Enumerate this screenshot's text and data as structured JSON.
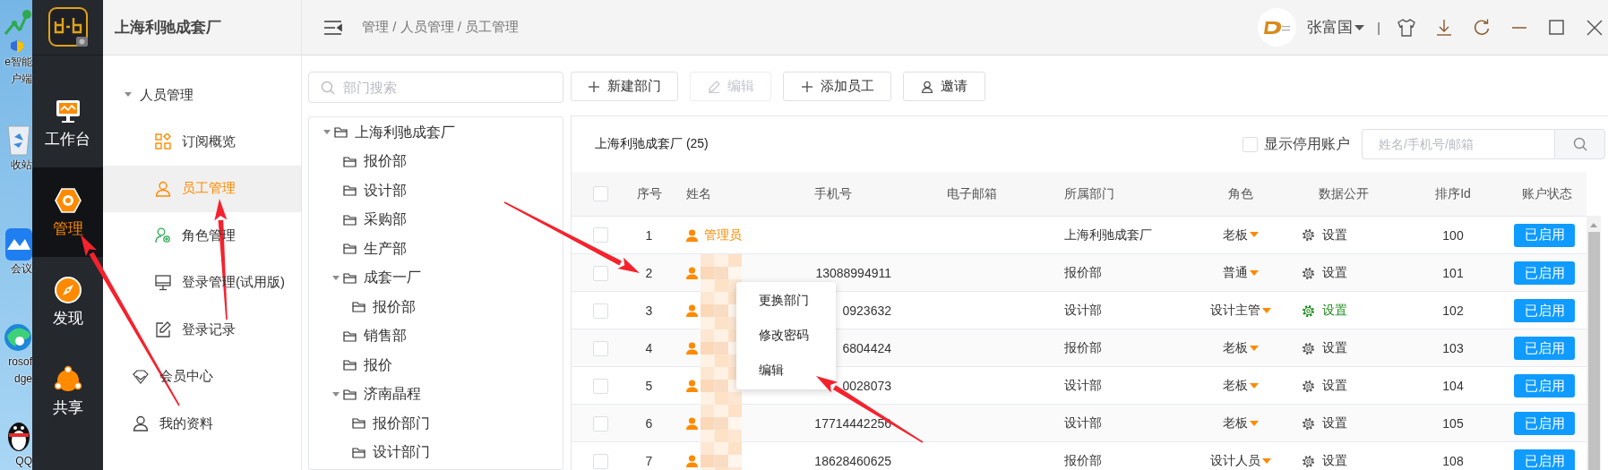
{
  "desktop": {
    "icons": [
      {
        "kind": "network",
        "lines": [
          "e智能",
          "户端"
        ]
      },
      {
        "kind": "bin",
        "lines": [
          "收站"
        ]
      },
      {
        "kind": "meeting",
        "lines": [
          "会议"
        ]
      },
      {
        "kind": "browser",
        "lines": [
          "rosof",
          "dge"
        ]
      },
      {
        "kind": "penguin",
        "lines": [
          "QQ"
        ]
      }
    ]
  },
  "nav": {
    "items": [
      {
        "kind": "workbench",
        "label": "工作台",
        "selected": false
      },
      {
        "kind": "manage",
        "label": "管理",
        "selected": true
      },
      {
        "kind": "discover",
        "label": "发现",
        "selected": false
      },
      {
        "kind": "share",
        "label": "共享",
        "selected": false
      }
    ]
  },
  "sidebar": {
    "title": "上海利驰成套厂",
    "items": [
      {
        "label": "人员管理",
        "expanded": true,
        "children": [
          {
            "kind": "grid",
            "label": "订阅概览",
            "selected": false
          },
          {
            "kind": "user",
            "label": "员工管理",
            "selected": true
          },
          {
            "kind": "role",
            "label": "角色管理",
            "selected": false
          },
          {
            "kind": "monitor",
            "label": "登录管理(试用版)",
            "selected": false
          },
          {
            "kind": "edit",
            "label": "登录记录",
            "selected": false
          }
        ]
      },
      {
        "kind": "diamond",
        "label": "会员中心",
        "selected": false
      },
      {
        "kind": "user",
        "label": "我的资料",
        "selected": false
      }
    ]
  },
  "topbar": {
    "breadcrumb": "管理 / 人员管理 / 员工管理",
    "user": "张富国",
    "divider": "|"
  },
  "dept_search": {
    "placeholder": "部门搜索"
  },
  "tree": [
    {
      "label": "上海利驰成套厂",
      "expanded": true,
      "children": [
        {
          "label": "报价部"
        },
        {
          "label": "设计部"
        },
        {
          "label": "采购部"
        },
        {
          "label": "生产部"
        },
        {
          "label": "成套一厂",
          "expanded": true,
          "children": [
            {
              "label": "报价部"
            }
          ]
        },
        {
          "label": "销售部"
        },
        {
          "label": "报价"
        },
        {
          "label": "济南晶程",
          "expanded": true,
          "children": [
            {
              "label": "报价部门"
            },
            {
              "label": "设计部门"
            }
          ]
        }
      ]
    }
  ],
  "toolbar": [
    {
      "kind": "plus",
      "label": "新建部门",
      "disabled": false
    },
    {
      "kind": "pencil",
      "label": "编辑",
      "disabled": true
    },
    {
      "kind": "plus",
      "label": "添加员工",
      "disabled": false
    },
    {
      "kind": "user",
      "label": "邀请",
      "disabled": false
    }
  ],
  "panel": {
    "title": "上海利驰成套厂 (25)",
    "show_disabled": {
      "label": "显示停用账户",
      "checked": false
    },
    "search": {
      "placeholder": "姓名/手机号/邮箱"
    }
  },
  "table": {
    "all_checked": false,
    "columns": [
      "序号",
      "姓名",
      "手机号",
      "电子邮箱",
      "所属部门",
      "角色",
      "数据公开",
      "排序Id",
      "账户状态"
    ],
    "rows": [
      {
        "checked": false,
        "index": "1",
        "name": "管理员",
        "department": "上海利驰成套厂",
        "role": "老板",
        "data_public": {
          "label": "设置",
          "active": false
        },
        "sort_id": "100",
        "status": "已启用"
      },
      {
        "checked": false,
        "index": "2",
        "phone": "13088994911",
        "department": "报价部",
        "role": "普通",
        "data_public": {
          "label": "设置",
          "active": false
        },
        "sort_id": "101",
        "status": "已启用"
      },
      {
        "checked": false,
        "index": "3",
        "phone": "0923632",
        "department": "设计部",
        "role": "设计主管",
        "data_public": {
          "label": "设置",
          "active": true
        },
        "sort_id": "102",
        "status": "已启用"
      },
      {
        "checked": false,
        "index": "4",
        "phone": "6804424",
        "department": "报价部",
        "role": "老板",
        "data_public": {
          "label": "设置",
          "active": false
        },
        "sort_id": "103",
        "status": "已启用"
      },
      {
        "checked": false,
        "index": "5",
        "phone": "0028073",
        "department": "设计部",
        "role": "老板",
        "data_public": {
          "label": "设置",
          "active": false
        },
        "sort_id": "104",
        "status": "已启用"
      },
      {
        "checked": false,
        "index": "6",
        "phone": "17714442256",
        "department": "设计部",
        "role": "老板",
        "data_public": {
          "label": "设置",
          "active": false
        },
        "sort_id": "105",
        "status": "已启用"
      },
      {
        "checked": false,
        "index": "7",
        "phone": "18628460625",
        "department": "报价部",
        "role": "设计人员",
        "data_public": {
          "label": "设置",
          "active": false
        },
        "sort_id": "108",
        "status": "已启用"
      }
    ]
  },
  "context_menu": [
    "更换部门",
    "修改密码",
    "编辑"
  ]
}
